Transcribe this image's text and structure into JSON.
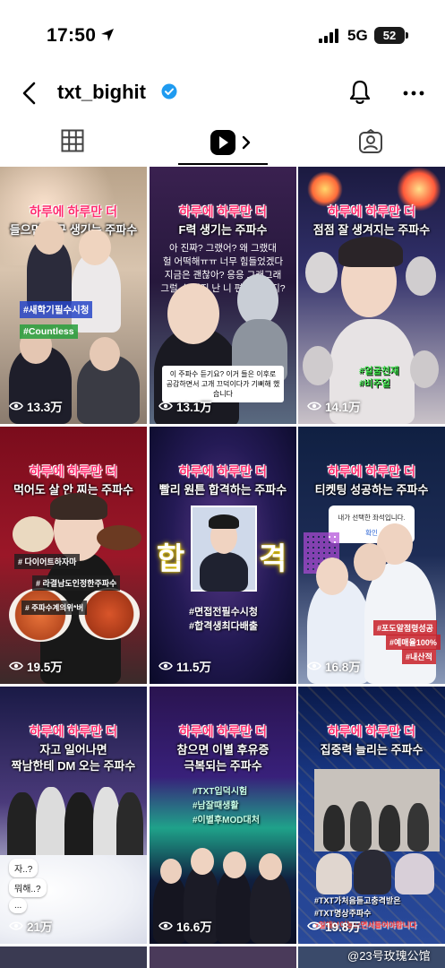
{
  "status_bar": {
    "time": "17:50",
    "network": "5G",
    "battery": "52"
  },
  "header": {
    "username": "txt_bighit"
  },
  "tiles": [
    {
      "cap1": "하루에 하루만 더",
      "cap2": "들으면 친구 생기는 주파수",
      "cap3": "",
      "views": "13.3万",
      "tags": [
        "#새학기필수시청",
        "#Countless"
      ]
    },
    {
      "cap1": "하루에 하루만 더",
      "cap2": "F력 생기는 주파수",
      "cap3": "",
      "lyrics": [
        "아 진짜? 그랬어? 왜 그랬대",
        "헐 어떡해ㅠㅠ 너무 힘들었겠다",
        "지금은 괜찮아? 응응 그래그래",
        "그럴 수 있지 난 니 편이야 알지?"
      ],
      "note": "이 주파수 듣기요? 이거 들은 이후로 공감하면서 고개 끄덕이다가 기뻐해 했습니다",
      "views": "13.1万"
    },
    {
      "cap1": "하루에 하루만 더",
      "cap2": "점점 잘 생겨지는 주파수",
      "cap3": "",
      "views": "14.1万",
      "tags": [
        "#얼굴천재",
        "#비주얼"
      ]
    },
    {
      "cap1": "하루에 하루만 더",
      "cap2": "먹어도 살 안 찌는 주파수",
      "cap3": "",
      "views": "19.5万",
      "tags": [
        "# 다이어트하자마",
        "# 라결남도인정한주파수",
        "# 주파수계의위*버"
      ]
    },
    {
      "cap1": "하루에 하루만 더",
      "cap2": "빨리 원튼 합격하는 주파수",
      "cap3": "",
      "views": "11.5万",
      "big_left": "합",
      "big_right": "격",
      "tags": [
        "#면접전필수시청",
        "#합격생최다배출"
      ]
    },
    {
      "cap1": "하루에 하루만 더",
      "cap2": "티켓팅 성공하는 주파수",
      "cap3": "",
      "views": "16.8万",
      "dialog": "내가 선택한 좌석입니다.",
      "dialog_btn": "확인",
      "tags": [
        "#포도알점령성공",
        "#예매율100%",
        "#내산적"
      ]
    },
    {
      "cap1": "하루에 하루만 더",
      "cap2": "자고 일어나면",
      "cap3": "짝남한테 DM 오는 주파수",
      "views": "21万",
      "bubbles": [
        "자..?",
        "뭐해..?",
        "..."
      ]
    },
    {
      "cap1": "하루에 하루만 더",
      "cap2": "참으면 이별 후유증",
      "cap3": "극복되는 주파수",
      "views": "16.6万",
      "tags": [
        "#TXT입덕시험",
        "#남잘때생활",
        "#이별후MOD대처"
      ]
    },
    {
      "cap1": "하루에 하루만 더",
      "cap2": "집중력 늘리는 주파수",
      "cap3": "",
      "views": "19.8万",
      "tags": [
        "#TXT가처음듣고충격받은",
        "#TXT명상주파수",
        "#일해보이놀으면서들어야합니다"
      ]
    }
  ],
  "watermark": "@23号玫瑰公馆"
}
